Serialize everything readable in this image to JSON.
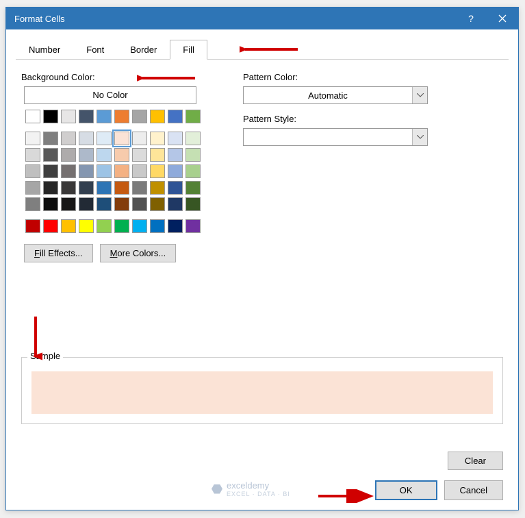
{
  "title": "Format Cells",
  "tabs": [
    {
      "label": "Number",
      "active": false
    },
    {
      "label": "Font",
      "active": false
    },
    {
      "label": "Border",
      "active": false
    },
    {
      "label": "Fill",
      "active": true
    }
  ],
  "bg_label": "Background Color:",
  "no_color": "No Color",
  "fill_effects": "Fill Effects...",
  "more_colors": "More Colors...",
  "pattern_color_label": "Pattern Color:",
  "pattern_color_value": "Automatic",
  "pattern_style_label": "Pattern Style:",
  "pattern_style_value": "",
  "sample_label": "Sample",
  "sample_color": "#fbe3d6",
  "clear": "Clear",
  "ok": "OK",
  "cancel": "Cancel",
  "watermark": {
    "brand": "exceldemy",
    "tag": "EXCEL · DATA · BI"
  },
  "palette_row1": [
    "#ffffff",
    "#000000",
    "#e7e6e6",
    "#44546a",
    "#5b9bd5",
    "#ed7d31",
    "#a5a5a5",
    "#ffc000",
    "#4472c4",
    "#70ad47"
  ],
  "palette_theme": [
    [
      "#f2f2f2",
      "#7f7f7f",
      "#d0cece",
      "#d6dce4",
      "#deebf6",
      "#fbe3d6",
      "#ededed",
      "#fff2cc",
      "#d9e2f3",
      "#e2efd9"
    ],
    [
      "#d9d9d9",
      "#595959",
      "#aeabab",
      "#adb9ca",
      "#bdd7ee",
      "#f7cbac",
      "#dbdbdb",
      "#fee599",
      "#b4c6e7",
      "#c5e0b3"
    ],
    [
      "#bfbfbf",
      "#3f3f3f",
      "#757070",
      "#8496b0",
      "#9cc3e5",
      "#f4b183",
      "#c9c9c9",
      "#ffd965",
      "#8eaadb",
      "#a8d08d"
    ],
    [
      "#a6a6a6",
      "#262626",
      "#3a3838",
      "#323f4f",
      "#2e75b5",
      "#c55a11",
      "#7b7b7b",
      "#bf9000",
      "#2f5496",
      "#538135"
    ],
    [
      "#7f7f7f",
      "#0d0d0d",
      "#171616",
      "#222a35",
      "#1e4e79",
      "#833c0b",
      "#525252",
      "#7f6000",
      "#1f3864",
      "#375623"
    ]
  ],
  "palette_std": [
    "#c00000",
    "#ff0000",
    "#ffc000",
    "#ffff00",
    "#92d050",
    "#00b050",
    "#00b0f0",
    "#0070c0",
    "#002060",
    "#7030a0"
  ],
  "selected_swatch": "#fbe3d6"
}
